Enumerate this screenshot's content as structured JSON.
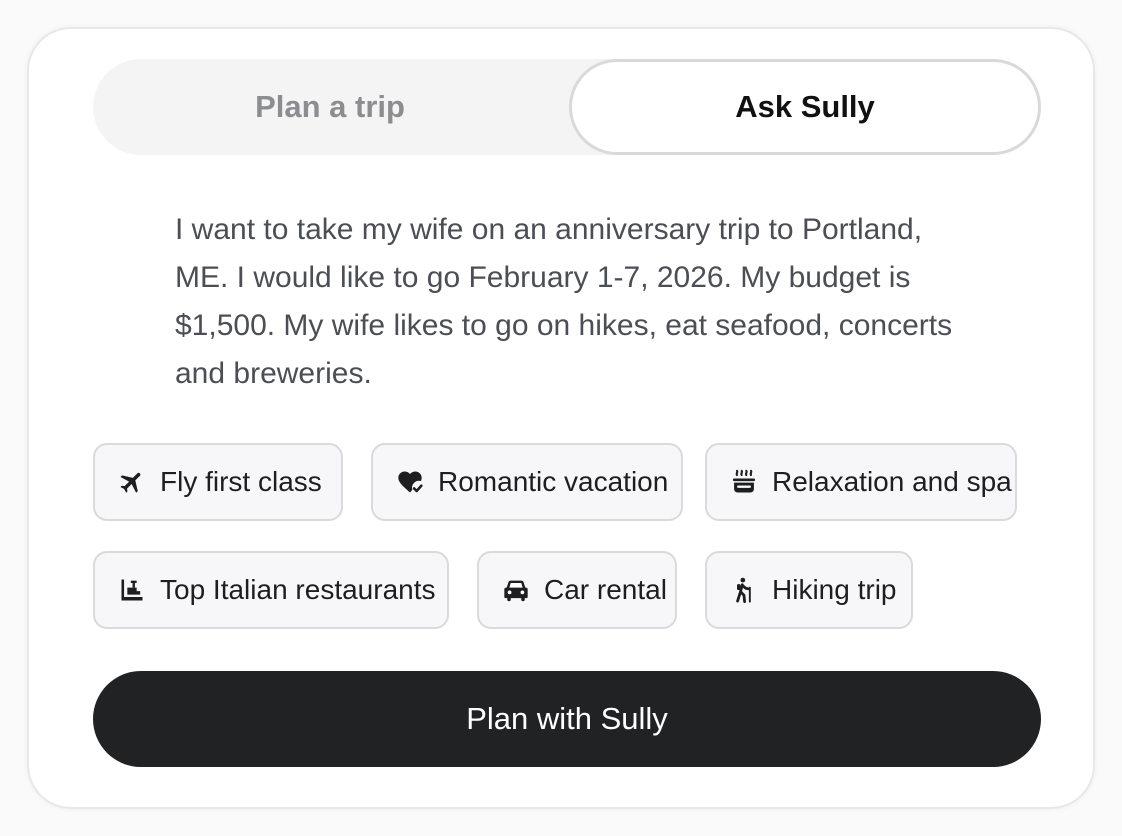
{
  "tabs": {
    "plan_trip": "Plan a trip",
    "ask_sully": "Ask Sully",
    "active": "ask_sully"
  },
  "prompt": {
    "text": "I want to take my wife on an anniversary trip to Portland,\nME. I would like to go February 1-7, 2026. My budget is\n$1,500. My wife likes to go on hikes, eat seafood, concerts\nand breweries."
  },
  "suggestions": [
    {
      "label": "Fly first class",
      "icon": "airplane-icon"
    },
    {
      "label": "Romantic vacation",
      "icon": "heart-check-icon"
    },
    {
      "label": "Relaxation and spa",
      "icon": "hot-tub-icon"
    },
    {
      "label": "Top Italian restaurants",
      "icon": "restaurant-icon"
    },
    {
      "label": "Car rental",
      "icon": "car-icon"
    },
    {
      "label": "Hiking trip",
      "icon": "hiker-icon"
    }
  ],
  "cta": {
    "label": "Plan with Sully"
  },
  "colors": {
    "cta_background": "#212224",
    "active_tab_border": "#d9d9dc",
    "tab_track": "#f4f4f5",
    "chip_background": "#f7f7f9"
  }
}
